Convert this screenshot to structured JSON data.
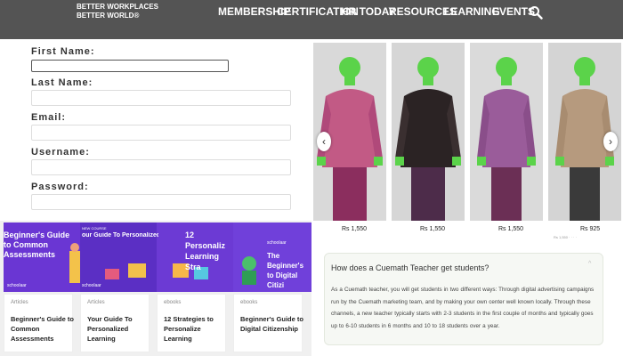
{
  "header": {
    "logo_line1": "BETTER WORKPLACES",
    "logo_line2": "BETTER WORLD®",
    "menu": [
      "MEMBERSHIP",
      "CERTIFICATION",
      "HR TODAY",
      "RESOURCES",
      "LEARNING",
      "EVENTS"
    ],
    "search_icon": "search-icon"
  },
  "form": {
    "first_name_label": "First Name:",
    "last_name_label": "Last Name:",
    "email_label": "Email:",
    "username_label": "Username:",
    "password_label": "Password:"
  },
  "products": [
    {
      "price": "Rs 1,550",
      "shirt": "#b8537a"
    },
    {
      "price": "Rs 1,550",
      "shirt": "#2b2324"
    },
    {
      "price": "Rs 1,550",
      "shirt": "#9a5c9a"
    },
    {
      "price": "Rs 925",
      "shirt": "#b69a7e"
    }
  ],
  "carousel": {
    "prev": "‹",
    "next": "›",
    "small_text": "Rs 1,550 · · · ·"
  },
  "cards": [
    {
      "tag": "Articles",
      "title": "Beginner's Guide to Common Assessments"
    },
    {
      "tag": "Articles",
      "title": "Your Guide To Personalized Learning"
    },
    {
      "tag": "ebooks",
      "title": "12 Strategies to Personalize Learning"
    },
    {
      "tag": "ebooks",
      "title": "Beginner's Guide to Digital Citizenship"
    }
  ],
  "banners": {
    "b1": "Beginner's Guide to Common Assessments",
    "b1_brand": "schoolaar",
    "b2_top": "NEW COURSE",
    "b2": "our Guide To Personalized L",
    "b2_brand": "schoolaar",
    "b3": "12 Personaliz Learning Stra",
    "b4_brand": "schoolaar",
    "b4": "The Beginner's to Digital Citizi"
  },
  "faq": {
    "question": "How does a Cuemath Teacher get students?",
    "chevron": "^",
    "answer": "As a Cuemath teacher, you will get students in two different ways: Through digital advertising campaigns run by the Cuemath marketing team, and by making your own center well known locally. Through these channels, a new teacher typically starts with 2-3 students in the first couple of months and typically goes up to 6-10 students in 6 months and 10 to 18 students over a year."
  }
}
